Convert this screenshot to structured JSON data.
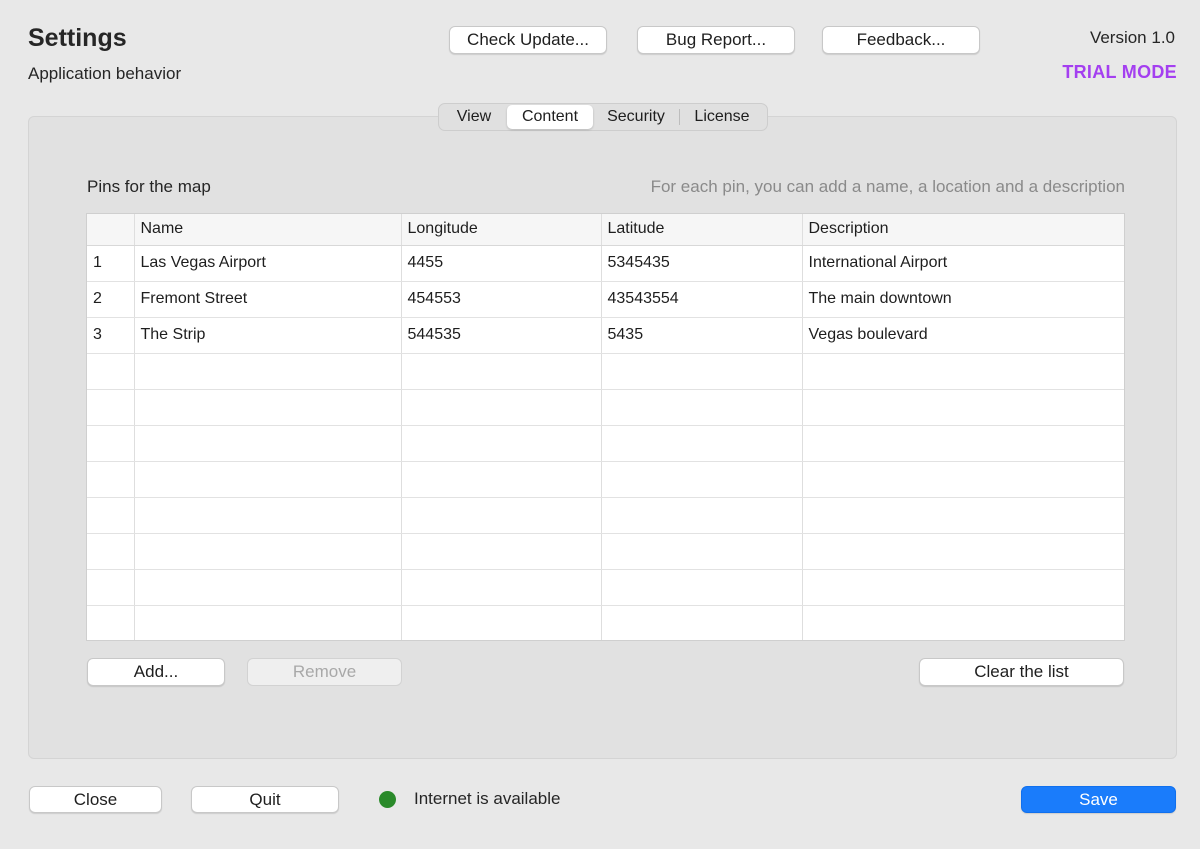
{
  "header": {
    "title": "Settings",
    "subtitle": "Application behavior",
    "version": "Version 1.0",
    "mode": "TRIAL MODE",
    "mode_color": "#a43ff0",
    "buttons": {
      "check_update": "Check Update...",
      "bug_report": "Bug Report...",
      "feedback": "Feedback..."
    }
  },
  "tabs": [
    {
      "label": "View",
      "active": false
    },
    {
      "label": "Content",
      "active": true
    },
    {
      "label": "Security",
      "active": false
    },
    {
      "label": "License",
      "active": false
    }
  ],
  "content": {
    "section_title": "Pins for the map",
    "hint": "For each pin, you can add a name, a location and a description",
    "table": {
      "columns": [
        "",
        "Name",
        "Longitude",
        "Latitude",
        "Description"
      ],
      "rows": [
        [
          "1",
          "Las Vegas Airport",
          "4455",
          "5345435",
          "International Airport"
        ],
        [
          "2",
          "Fremont Street",
          "454553",
          "43543554",
          "The main downtown"
        ],
        [
          "3",
          "The Strip",
          "544535",
          "5435",
          "Vegas boulevard"
        ]
      ]
    },
    "buttons": {
      "add": "Add...",
      "remove": "Remove",
      "clear": "Clear the list"
    }
  },
  "footer": {
    "close": "Close",
    "quit": "Quit",
    "status_text": "Internet is available",
    "status_color": "#2a8a2a",
    "save": "Save",
    "save_color": "#1a7cfb"
  }
}
